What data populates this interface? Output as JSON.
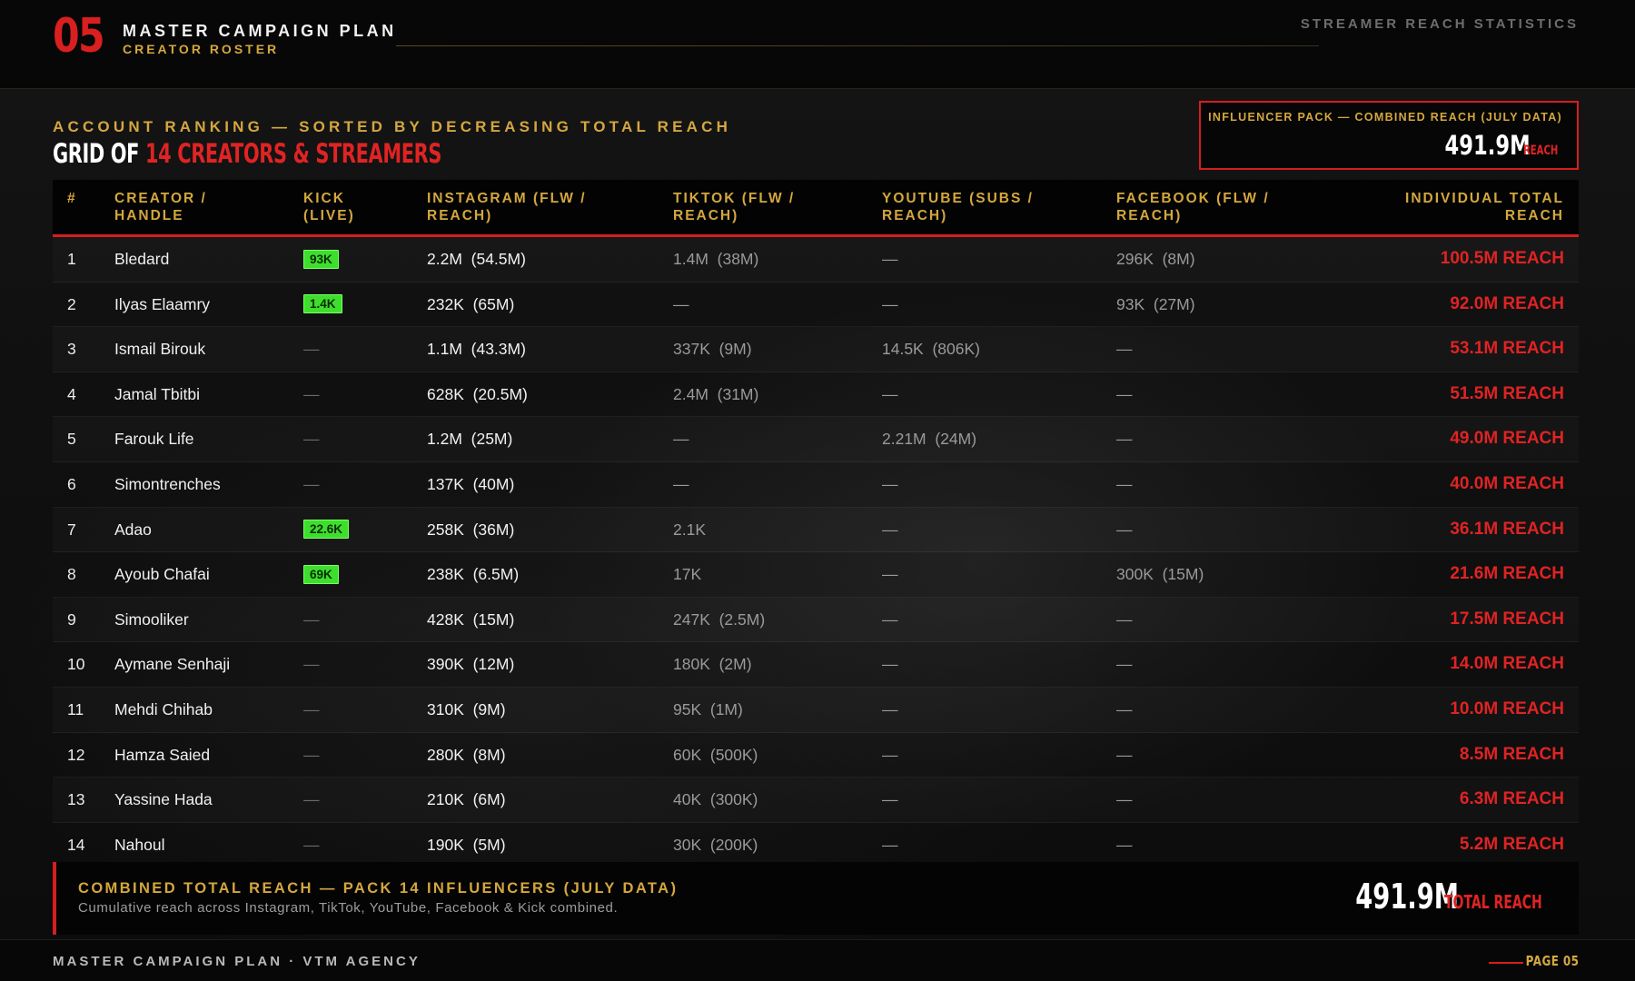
{
  "header": {
    "section_number": "05",
    "title": "MASTER CAMPAIGN PLAN",
    "subtitle": "CREATOR ROSTER",
    "right_label": "STREAMER REACH STATISTICS"
  },
  "heading": {
    "kicker": "ACCOUNT RANKING — SORTED BY DECREASING TOTAL REACH",
    "grid_title_prefix": "GRID OF",
    "grid_title_highlight": "14 CREATORS & STREAMERS"
  },
  "pack_summary": {
    "label": "INFLUENCER PACK — COMBINED REACH (JULY DATA)",
    "value": "491.9M",
    "unit": "REACH"
  },
  "table": {
    "columns": [
      "#",
      "CREATOR / HANDLE",
      "KICK (LIVE)",
      "INSTAGRAM (FLW / REACH)",
      "TIKTOK (FLW / REACH)",
      "YOUTUBE (SUBS / REACH)",
      "FACEBOOK (FLW / REACH)",
      "INDIVIDUAL TOTAL REACH"
    ],
    "rows": [
      {
        "rank": "1",
        "name": "Bledard",
        "kick": "93K",
        "kick_live": true,
        "instagram": "2.2M  (54.5M)",
        "tiktok": "1.4M  (38M)",
        "youtube": "—",
        "facebook": "296K  (8M)",
        "total": "100.5M REACH"
      },
      {
        "rank": "2",
        "name": "Ilyas Elaamry",
        "kick": "1.4K",
        "kick_live": true,
        "instagram": "232K  (65M)",
        "tiktok": "—",
        "youtube": "—",
        "facebook": "93K  (27M)",
        "total": "92.0M REACH"
      },
      {
        "rank": "3",
        "name": "Ismail Birouk",
        "kick": "—",
        "kick_live": false,
        "instagram": "1.1M  (43.3M)",
        "tiktok": "337K  (9M)",
        "youtube": "14.5K  (806K)",
        "facebook": "—",
        "total": "53.1M REACH"
      },
      {
        "rank": "4",
        "name": "Jamal Tbitbi",
        "kick": "—",
        "kick_live": false,
        "instagram": "628K  (20.5M)",
        "tiktok": "2.4M  (31M)",
        "youtube": "—",
        "facebook": "—",
        "total": "51.5M REACH"
      },
      {
        "rank": "5",
        "name": "Farouk Life",
        "kick": "—",
        "kick_live": false,
        "instagram": "1.2M  (25M)",
        "tiktok": "—",
        "youtube": "2.21M  (24M)",
        "facebook": "—",
        "total": "49.0M REACH"
      },
      {
        "rank": "6",
        "name": "Simontrenches",
        "kick": "—",
        "kick_live": false,
        "instagram": "137K  (40M)",
        "tiktok": "—",
        "youtube": "—",
        "facebook": "—",
        "total": "40.0M REACH"
      },
      {
        "rank": "7",
        "name": "Adao",
        "kick": "22.6K",
        "kick_live": true,
        "instagram": "258K  (36M)",
        "tiktok": "2.1K",
        "youtube": "—",
        "facebook": "—",
        "total": "36.1M REACH"
      },
      {
        "rank": "8",
        "name": "Ayoub Chafai",
        "kick": "69K",
        "kick_live": true,
        "instagram": "238K  (6.5M)",
        "tiktok": "17K",
        "youtube": "—",
        "facebook": "300K  (15M)",
        "total": "21.6M REACH"
      },
      {
        "rank": "9",
        "name": "Simooliker",
        "kick": "—",
        "kick_live": false,
        "instagram": "428K  (15M)",
        "tiktok": "247K  (2.5M)",
        "youtube": "—",
        "facebook": "—",
        "total": "17.5M REACH"
      },
      {
        "rank": "10",
        "name": "Aymane Senhaji",
        "kick": "—",
        "kick_live": false,
        "instagram": "390K  (12M)",
        "tiktok": "180K  (2M)",
        "youtube": "—",
        "facebook": "—",
        "total": "14.0M REACH"
      },
      {
        "rank": "11",
        "name": "Mehdi Chihab",
        "kick": "—",
        "kick_live": false,
        "instagram": "310K  (9M)",
        "tiktok": "95K  (1M)",
        "youtube": "—",
        "facebook": "—",
        "total": "10.0M REACH"
      },
      {
        "rank": "12",
        "name": "Hamza Saied",
        "kick": "—",
        "kick_live": false,
        "instagram": "280K  (8M)",
        "tiktok": "60K  (500K)",
        "youtube": "—",
        "facebook": "—",
        "total": "8.5M REACH"
      },
      {
        "rank": "13",
        "name": "Yassine Hada",
        "kick": "—",
        "kick_live": false,
        "instagram": "210K  (6M)",
        "tiktok": "40K  (300K)",
        "youtube": "—",
        "facebook": "—",
        "total": "6.3M REACH"
      },
      {
        "rank": "14",
        "name": "Nahoul",
        "kick": "—",
        "kick_live": false,
        "instagram": "190K  (5M)",
        "tiktok": "30K  (200K)",
        "youtube": "—",
        "facebook": "—",
        "total": "5.2M REACH"
      }
    ]
  },
  "total_box": {
    "title": "COMBINED TOTAL REACH — PACK 14 INFLUENCERS (JULY DATA)",
    "subtitle": "Cumulative reach across Instagram, TikTok, YouTube, Facebook & Kick combined.",
    "value": "491.9M",
    "unit": "TOTAL REACH"
  },
  "footer": {
    "left": "MASTER CAMPAIGN PLAN · VTM AGENCY",
    "right": "PAGE 05"
  },
  "colors": {
    "accent_red": "#d61e1e",
    "accent_gold": "#d4a73e",
    "live_green": "#3ddf2c",
    "background": "#0b0b0b"
  }
}
